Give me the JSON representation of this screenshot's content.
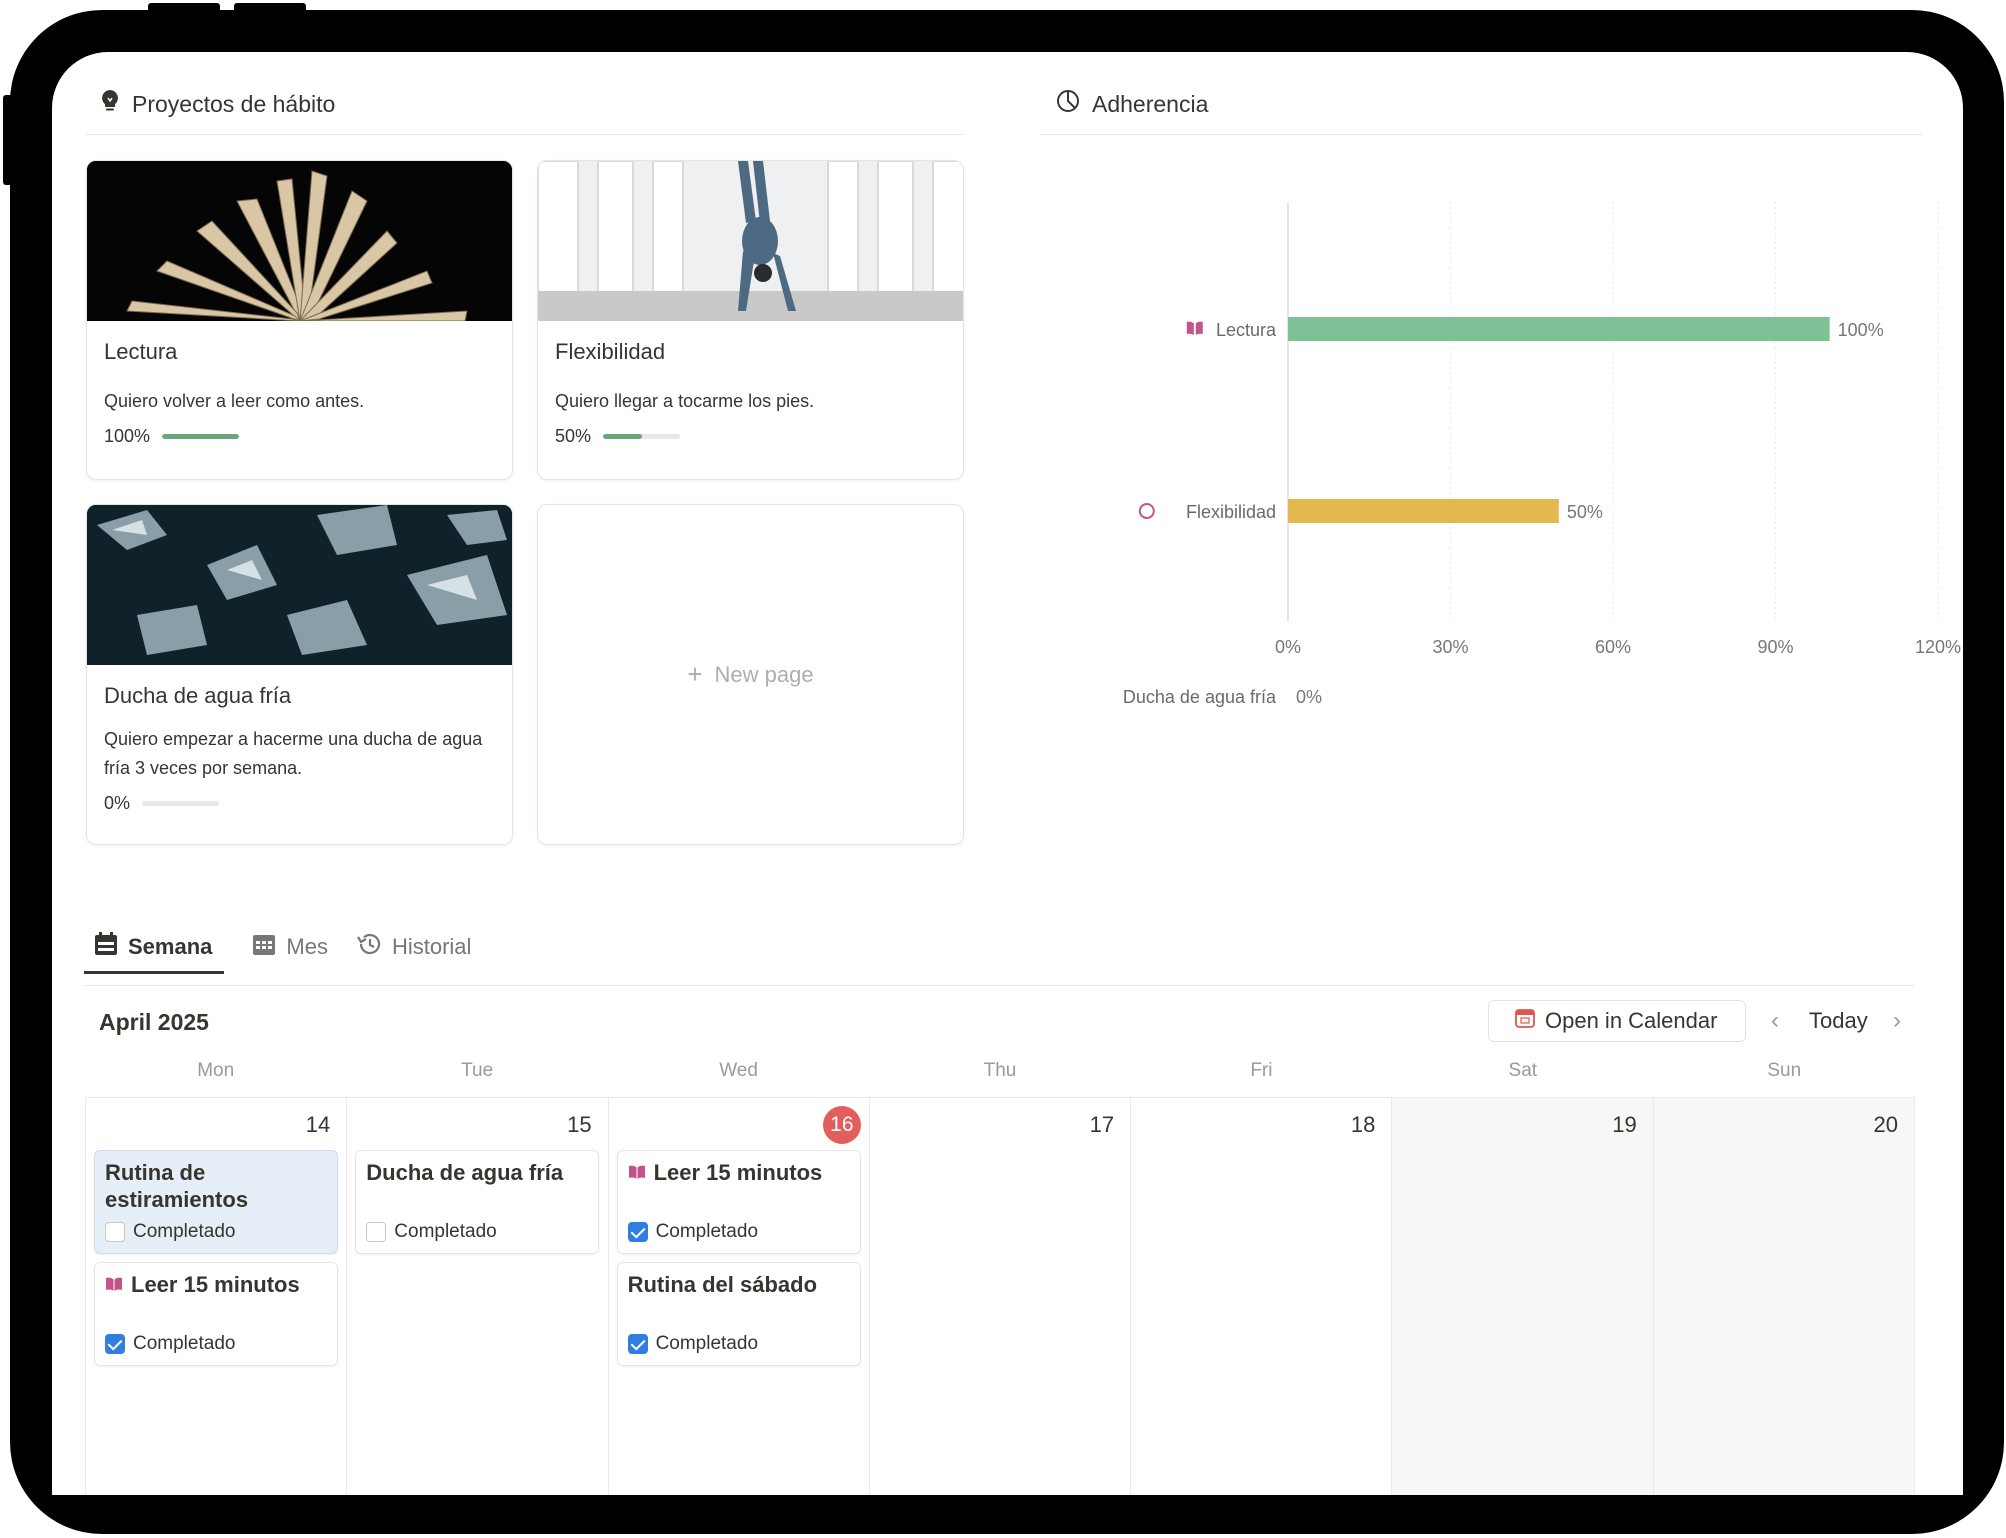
{
  "colors": {
    "accent_green": "#6aa57c",
    "chart_green": "#7fc197",
    "chart_yellow": "#e3b84f",
    "today_red": "#e25d5b",
    "check_blue": "#2f7ee0",
    "lectura_pink": "#c4538a"
  },
  "left_section": {
    "title": "Proyectos de hábito",
    "icon": "lightbulb-icon"
  },
  "right_section": {
    "title": "Adherencia",
    "icon": "pie-chart-icon"
  },
  "cards": [
    {
      "title": "Lectura",
      "desc": "Quiero volver a leer como antes.",
      "progress_label": "100%",
      "progress": 1.0
    },
    {
      "title": "Flexibilidad",
      "desc": "Quiero llegar a tocarme los pies.",
      "progress_label": "50%",
      "progress": 0.5
    },
    {
      "title": "Ducha de agua fría",
      "desc": "Quiero empezar a hacerme una ducha de agua fría 3 veces por semana.",
      "progress_label": "0%",
      "progress": 0.0
    }
  ],
  "new_page": {
    "label": "New page",
    "icon": "plus-icon"
  },
  "chart_data": {
    "type": "bar",
    "orientation": "horizontal",
    "categories": [
      "Lectura",
      "Flexibilidad",
      "Ducha de agua fría"
    ],
    "category_icons": [
      "book-icon",
      "circle-icon",
      ""
    ],
    "values": [
      100,
      50,
      0
    ],
    "value_labels": [
      "100%",
      "50%",
      "0%"
    ],
    "colors": [
      "#7fc197",
      "#e3b84f",
      "#cccccc"
    ],
    "xlim": [
      0,
      120
    ],
    "xticks": [
      "0%",
      "30%",
      "60%",
      "90%",
      "120%"
    ],
    "grid": true,
    "title": "",
    "xlabel": "",
    "ylabel": ""
  },
  "tabs": [
    {
      "label": "Semana",
      "icon": "calendar-week-icon",
      "active": true
    },
    {
      "label": "Mes",
      "icon": "calendar-month-icon",
      "active": false
    },
    {
      "label": "Historial",
      "icon": "history-icon",
      "active": false
    }
  ],
  "calendar": {
    "month": "April 2025",
    "open_button": "Open in Calendar",
    "today": "Today",
    "weekdays": [
      "Mon",
      "Tue",
      "Wed",
      "Thu",
      "Fri",
      "Sat",
      "Sun"
    ],
    "days": [
      "14",
      "15",
      "16",
      "17",
      "18",
      "19",
      "20"
    ],
    "events": {
      "mon_1": {
        "title": "Rutina de estiramientos",
        "check_label": "Completado",
        "checked": false
      },
      "mon_2": {
        "title": "Leer 15 minutos",
        "check_label": "Completado",
        "checked": true
      },
      "tue_1": {
        "title": "Ducha de agua fría",
        "check_label": "Completado",
        "checked": false
      },
      "wed_1": {
        "title": "Leer 15 minutos",
        "check_label": "Completado",
        "checked": true
      },
      "wed_2": {
        "title": "Rutina del sábado",
        "check_label": "Completado",
        "checked": true
      }
    }
  }
}
